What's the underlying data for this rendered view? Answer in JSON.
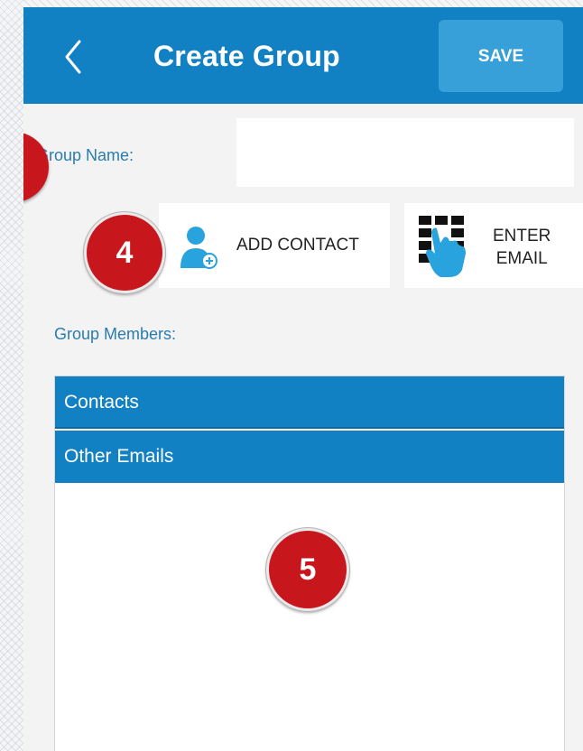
{
  "header": {
    "title": "Create Group",
    "save_label": "SAVE",
    "back_icon": "chevron-left-icon"
  },
  "form": {
    "group_name_label": "Group Name:",
    "group_name_value": "",
    "add_contact_label": "ADD CONTACT",
    "enter_email_line1": "ENTER",
    "enter_email_line2": "EMAIL",
    "group_members_label": "Group Members:"
  },
  "members": {
    "sections": [
      {
        "label": "Contacts"
      },
      {
        "label": "Other Emails"
      }
    ]
  },
  "annotations": {
    "step4": "4",
    "step5": "5"
  },
  "colors": {
    "primary": "#1281c4",
    "save_button": "#37a0d8",
    "label_text": "#2a7cb0",
    "badge": "#c8161d"
  }
}
